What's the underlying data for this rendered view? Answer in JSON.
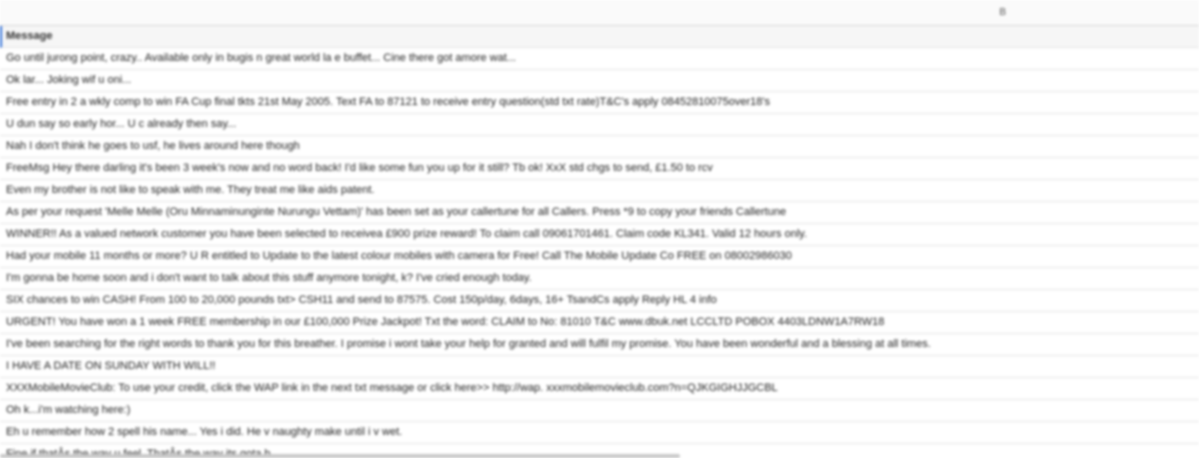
{
  "column_letter": "B",
  "header": "Message",
  "rows": [
    "Go until jurong point, crazy.. Available only in bugis n great world la e buffet... Cine there got amore wat...",
    "Ok lar... Joking wif u oni...",
    "Free entry in 2 a wkly comp to win FA Cup final tkts 21st May 2005. Text FA to 87121 to receive entry question(std txt rate)T&C's apply 08452810075over18's",
    "U dun say so early hor... U c already then say...",
    "Nah I don't think he goes to usf, he lives around here though",
    "FreeMsg Hey there darling it's been 3 week's now and no word back! I'd like some fun you up for it still? Tb ok! XxX std chgs to send, £1.50 to rcv",
    "Even my brother is not like to speak with me. They treat me like aids patent.",
    "As per your request 'Melle Melle (Oru Minnaminunginte Nurungu Vettam)' has been set as your callertune for all Callers. Press *9 to copy your friends Callertune",
    "WINNER!! As a valued network customer you have been selected to receivea £900 prize reward! To claim call 09061701461. Claim code KL341. Valid 12 hours only.",
    "Had your mobile 11 months or more? U R entitled to Update to the latest colour mobiles with camera for Free! Call The Mobile Update Co FREE on 08002986030",
    "I'm gonna be home soon and i don't want to talk about this stuff anymore tonight, k? I've cried enough today.",
    "SIX chances to win CASH! From 100 to 20,000 pounds txt> CSH11 and send to 87575. Cost 150p/day, 6days, 16+ TsandCs apply Reply HL 4 info",
    "URGENT! You have won a 1 week FREE membership in our £100,000 Prize Jackpot! Txt the word: CLAIM to No: 81010 T&C www.dbuk.net LCCLTD POBOX 4403LDNW1A7RW18",
    "I've been searching for the right words to thank you for this breather. I promise i wont take your help for granted and will fulfil my promise. You have been wonderful and a blessing at all times.",
    "I HAVE A DATE ON SUNDAY WITH WILL!!",
    "XXXMobileMovieClub: To use your credit, click the WAP link in the next txt message or click here>> http://wap. xxxmobilemovieclub.com?n=QJKGIGHJJGCBL",
    "Oh k...i'm watching here:)",
    "Eh u remember how 2 spell his name... Yes i did. He v naughty make until i v wet.",
    "Fine if thatÂs the way u feel. ThatÂs the way its gota b"
  ]
}
